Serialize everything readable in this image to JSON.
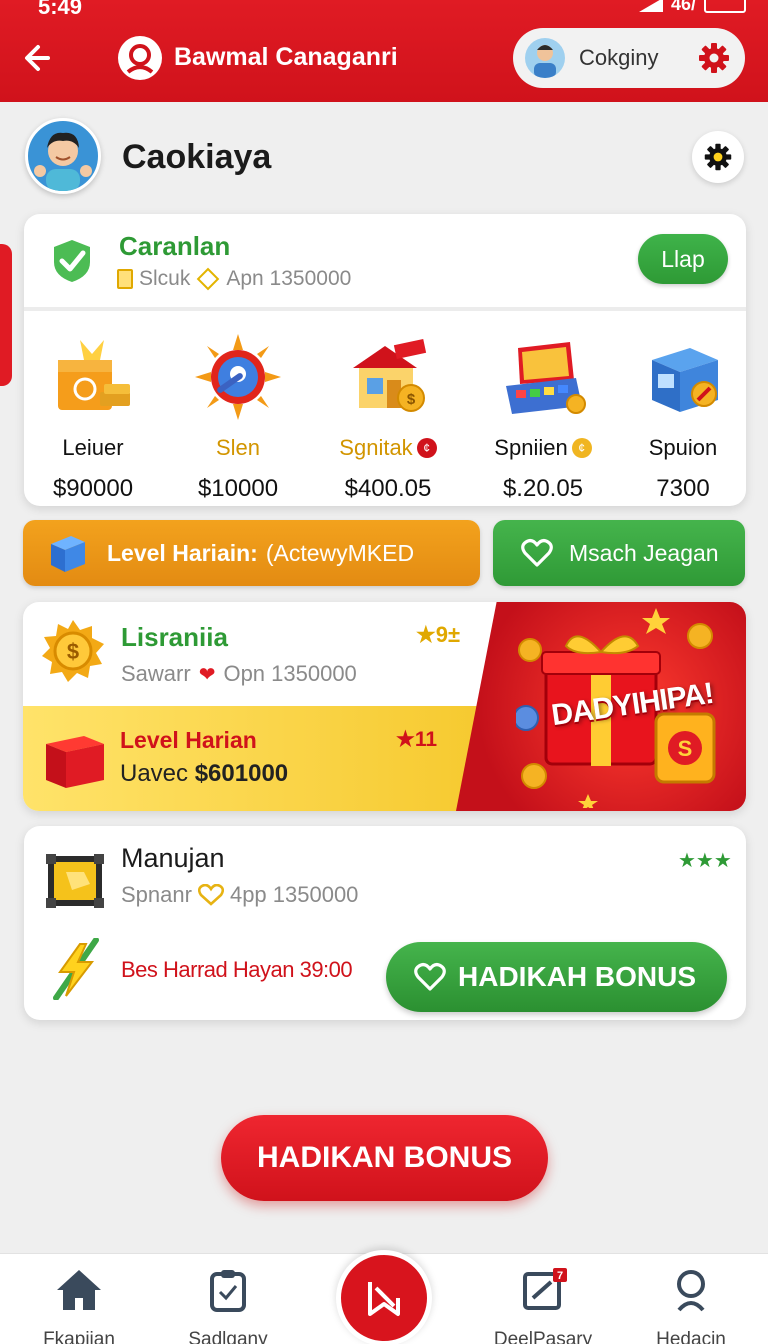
{
  "status_bar": {
    "time": "5:49",
    "network": "46/"
  },
  "header": {
    "title": "Bawmal Canaganri",
    "user_pill_name": "Cokginy"
  },
  "profile": {
    "name": "Caokiaya"
  },
  "card_status": {
    "title": "Caranlan",
    "sub_label": "Slcuk",
    "sub_text": "Apn 1350000",
    "button_label": "Llap"
  },
  "rewards": [
    {
      "label": "Leiuer",
      "value": "$90000",
      "label_color": "#111111"
    },
    {
      "label": "Slen",
      "value": "$10000",
      "label_color": "#d29500"
    },
    {
      "label": "Sgnitak",
      "value": "$400.05",
      "label_color": "#d29500"
    },
    {
      "label": "Spniien",
      "value": "$.20.05",
      "label_color": "#111111"
    },
    {
      "label": "Spuion",
      "value": "7300",
      "label_color": "#111111"
    }
  ],
  "actions": {
    "level_label": "Level Hariain:",
    "level_extra": "(ActewyMKED",
    "match_label": "Msach Jeagan"
  },
  "promo": {
    "title": "Lisraniia",
    "sub_label": "Sawarr",
    "sub_text": "Opn 1350000",
    "stars": "★9±",
    "level_title": "Level Harian",
    "level_stars": "★11",
    "prize_label": "Uavec",
    "prize_value": "$601000",
    "banner_text": "DADYIHIPA!"
  },
  "card_bonus": {
    "title": "Manujan",
    "stars": "★★★",
    "sub_label": "Spnanr",
    "sub_text": "4pp 1350000",
    "timer_text": "Bes Harrad Hayan 39:00",
    "button_label": "HADIKAH BONUS"
  },
  "cta": {
    "label": "HADIKAN BONUS"
  },
  "bottom_nav": [
    {
      "label": "Fkapiian"
    },
    {
      "label": "Sadlgany"
    },
    {
      "label": "DeelPasary",
      "badge": "7"
    },
    {
      "label": "Hedacin"
    }
  ],
  "colors": {
    "brand_red": "#d0121b",
    "accent_green": "#2e9a35",
    "accent_orange": "#e38b12",
    "accent_gold": "#e0a800"
  }
}
